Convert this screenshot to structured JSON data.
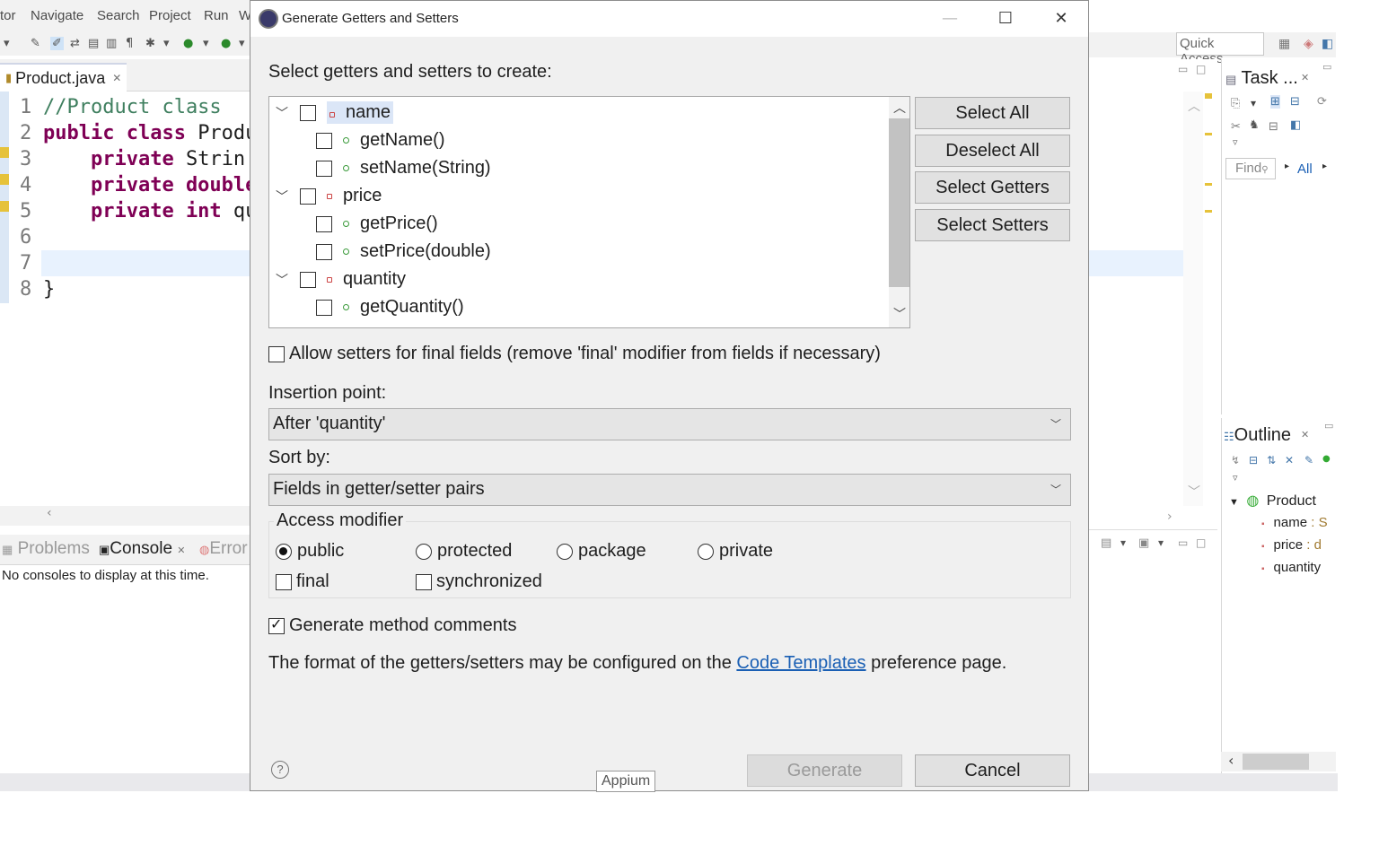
{
  "menubar": {
    "items": [
      "tor",
      "Navigate",
      "Search",
      "Project",
      "Run",
      "W"
    ]
  },
  "editor": {
    "tab_label": "Product.java",
    "code": [
      {
        "n": "1",
        "parts": [
          {
            "t": "//Product class",
            "c": "cm"
          }
        ]
      },
      {
        "n": "2",
        "parts": [
          {
            "t": "public class ",
            "c": "kw"
          },
          {
            "t": "Produ",
            "c": ""
          }
        ]
      },
      {
        "n": "3",
        "parts": [
          {
            "t": "    private ",
            "c": "kw"
          },
          {
            "t": "Strin",
            "c": ""
          }
        ]
      },
      {
        "n": "4",
        "parts": [
          {
            "t": "    private double",
            "c": "kw"
          }
        ]
      },
      {
        "n": "5",
        "parts": [
          {
            "t": "    private int ",
            "c": "kw"
          },
          {
            "t": "qu",
            "c": ""
          }
        ]
      },
      {
        "n": "6",
        "parts": []
      },
      {
        "n": "7",
        "parts": []
      },
      {
        "n": "8",
        "parts": [
          {
            "t": "}",
            "c": ""
          }
        ]
      }
    ]
  },
  "bottom_panel": {
    "tabs": [
      "Problems",
      "Console",
      "Error"
    ],
    "message": "No consoles to display at this time."
  },
  "right": {
    "quick_access": "Quick Access",
    "task_title": "Task ...",
    "find_placeholder": "Find",
    "all_label": "All",
    "outline_title": "Outline",
    "outline_root": "Product",
    "outline_items": [
      {
        "name": "name",
        "type": " : S"
      },
      {
        "name": "price",
        "type": " : d"
      },
      {
        "name": "quantity",
        "type": ""
      }
    ]
  },
  "dialog": {
    "title": "Generate Getters and Setters",
    "prompt": "Select getters and setters to create:",
    "tree": [
      {
        "label": "name",
        "level": 0,
        "expanded": true,
        "checked": false,
        "selected": true
      },
      {
        "label": "getName()",
        "level": 1,
        "checked": false
      },
      {
        "label": "setName(String)",
        "level": 1,
        "checked": false
      },
      {
        "label": "price",
        "level": 0,
        "expanded": true,
        "checked": false
      },
      {
        "label": "getPrice()",
        "level": 1,
        "checked": false
      },
      {
        "label": "setPrice(double)",
        "level": 1,
        "checked": false
      },
      {
        "label": "quantity",
        "level": 0,
        "expanded": true,
        "checked": false
      },
      {
        "label": "getQuantity()",
        "level": 1,
        "checked": false
      }
    ],
    "buttons": {
      "select_all": "Select All",
      "deselect_all": "Deselect All",
      "select_getters": "Select Getters",
      "select_setters": "Select Setters"
    },
    "allow_final_setters": {
      "label": "Allow setters for final fields (remove 'final' modifier from fields if necessary)",
      "checked": false
    },
    "insertion_point": {
      "label": "Insertion point:",
      "value": "After 'quantity'"
    },
    "sort_by": {
      "label": "Sort by:",
      "value": "Fields in getter/setter pairs"
    },
    "access_modifier": {
      "label": "Access modifier",
      "options": [
        "public",
        "protected",
        "package",
        "private"
      ],
      "selected": "public",
      "final_label": "final",
      "final_checked": false,
      "synchronized_label": "synchronized",
      "synchronized_checked": false
    },
    "generate_comments": {
      "label": "Generate method comments",
      "checked": true
    },
    "footer_text_before": "The format of the getters/setters may be configured on the ",
    "footer_link": "Code Templates",
    "footer_text_after": " preference page.",
    "generate_label": "Generate",
    "cancel_label": "Cancel",
    "help_symbol": "?",
    "tooltip": "Appium"
  },
  "colors": {
    "keyword": "#7f0055",
    "comment": "#3f7f5f",
    "link": "#1a5fb4",
    "selection": "#dbe6f7"
  }
}
